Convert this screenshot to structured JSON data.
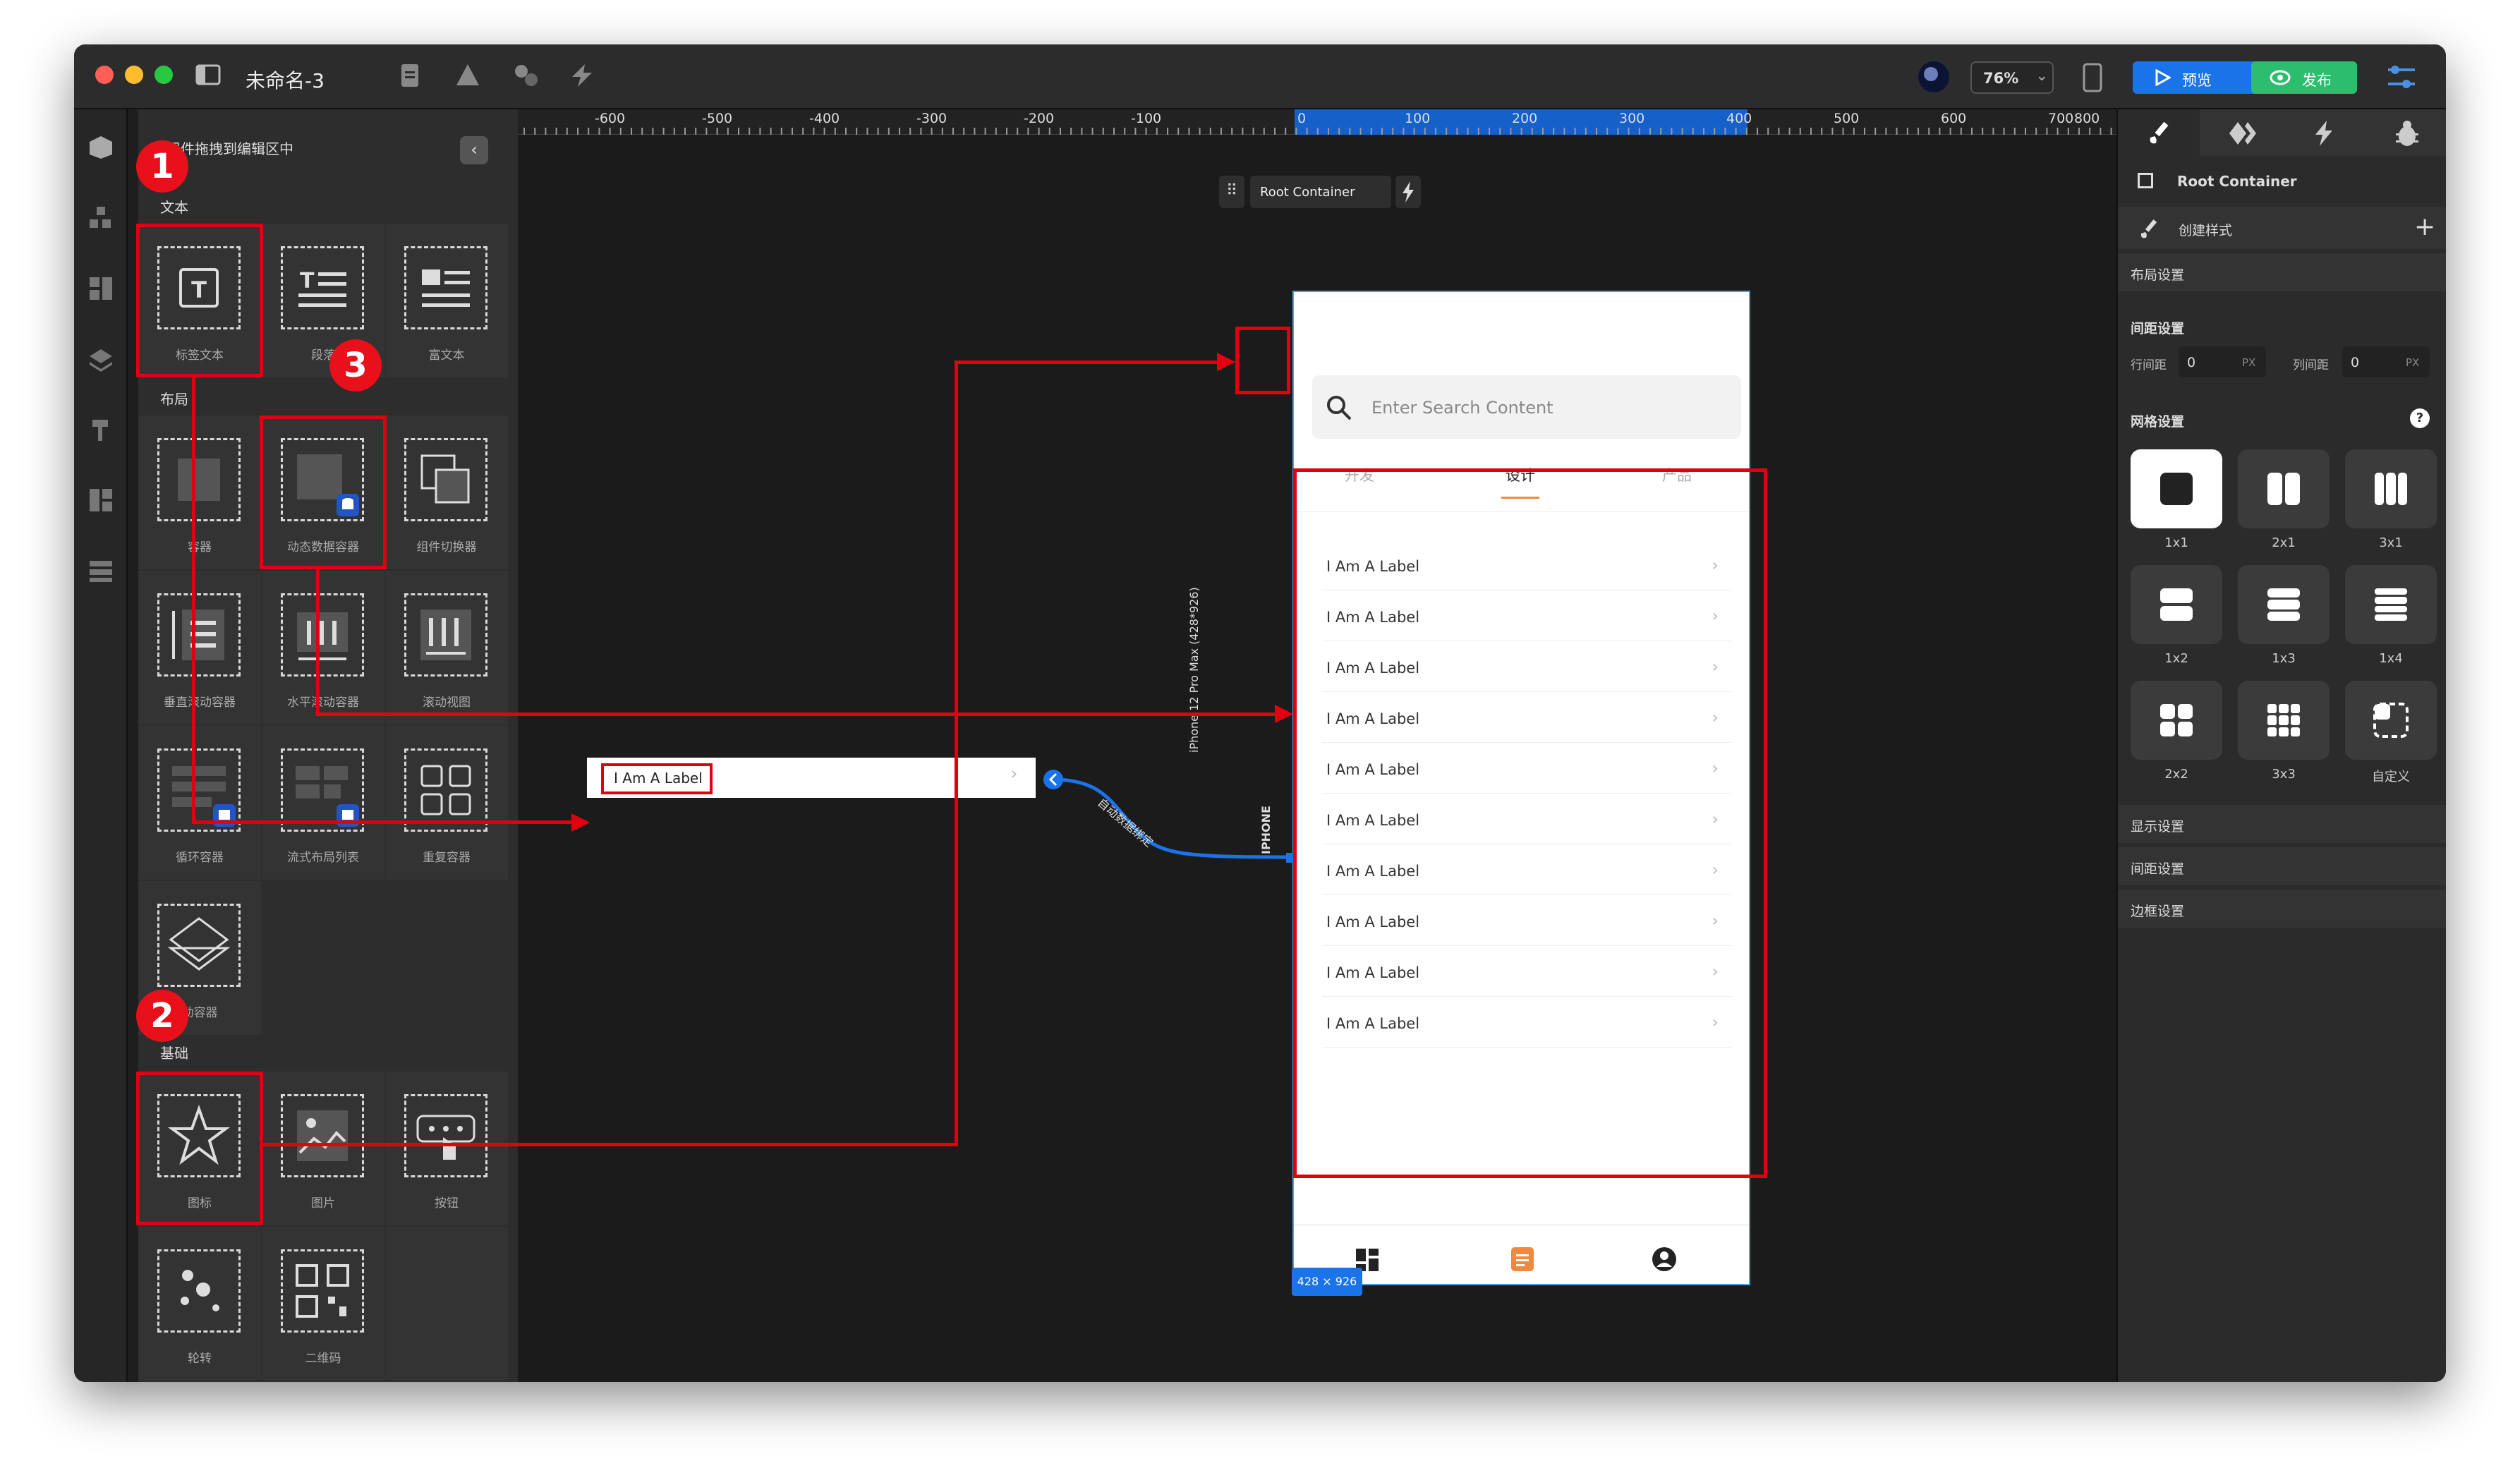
{
  "window": {
    "title": "未命名-3"
  },
  "toolbar": {
    "zoom": "76%",
    "preview_label": "预览",
    "publish_label": "发布"
  },
  "left_panel": {
    "hint": "将组件拖拽到编辑区中",
    "sections": {
      "text": "文本",
      "layout": "布局",
      "basic": "基础"
    },
    "text_items": [
      "标签文本",
      "段落",
      "富文本"
    ],
    "layout_items": [
      "容器",
      "动态数据容器",
      "组件切换器",
      "垂直滚动容器",
      "水平滚动容器",
      "滚动视图",
      "循环容器",
      "流式布局列表",
      "重复容器",
      "动容器"
    ],
    "basic_items": [
      "图标",
      "图片",
      "按钮",
      "轮转",
      "二维码"
    ]
  },
  "ruler": {
    "labels": [
      "-600",
      "-500",
      "-400",
      "-300",
      "-200",
      "-100",
      "0",
      "100",
      "200",
      "300",
      "400",
      "500",
      "600",
      "700",
      "800"
    ]
  },
  "canvas": {
    "root_label": "Root Container",
    "dragged_label": "I Am A Label",
    "connector_text": "自动数据绑定",
    "device_label": "iPhone 12 Pro Max (428*926)",
    "device_tag": "IPHONE",
    "size_tag": "428 × 926"
  },
  "phone": {
    "search_placeholder": "Enter Search Content",
    "tabs": [
      "开发",
      "设计",
      "产品"
    ],
    "active_tab": 1,
    "list": [
      "I Am A Label",
      "I Am A Label",
      "I Am A Label",
      "I Am A Label",
      "I Am A Label",
      "I Am A Label",
      "I Am A Label",
      "I Am A Label",
      "I Am A Label",
      "I Am A Label"
    ]
  },
  "right_panel": {
    "root": "Root Container",
    "create_style": "创建样式",
    "layout_settings": "布局设置",
    "spacing_settings": "间距设置",
    "row_gap_label": "行间距",
    "row_gap_value": "0",
    "row_gap_unit": "PX",
    "col_gap_label": "列间距",
    "col_gap_value": "0",
    "col_gap_unit": "PX",
    "grid_settings": "网格设置",
    "grid_options": [
      "1x1",
      "2x1",
      "3x1",
      "1x2",
      "1x3",
      "1x4",
      "2x2",
      "3x3",
      "自定义"
    ],
    "sections": [
      "显示设置",
      "间距设置",
      "边框设置"
    ]
  },
  "annotations": [
    "1",
    "2",
    "3"
  ],
  "colors": {
    "accent": "#1a73e8",
    "publish": "#2dbd6e",
    "highlight": "#e00010",
    "active_tab": "#f0883e"
  }
}
